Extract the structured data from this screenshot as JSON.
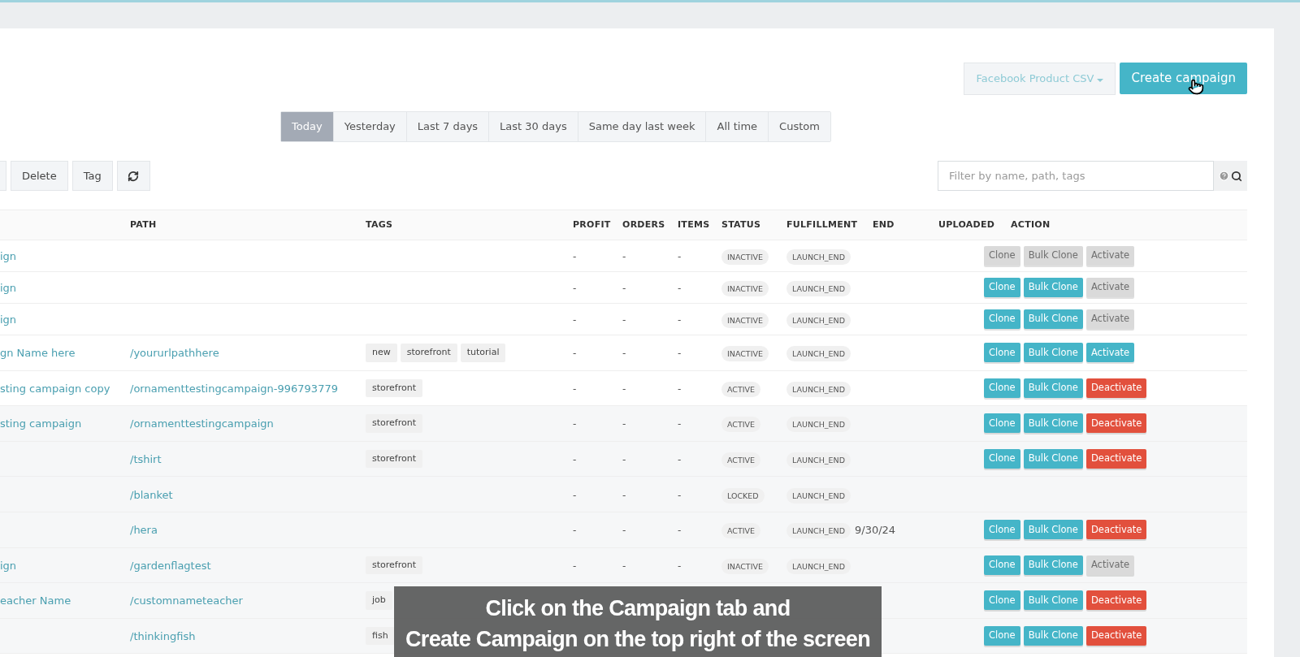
{
  "header_buttons": [
    {
      "label": "Facebook Product CSV",
      "kind": "dropdown"
    },
    {
      "label": "Create campaign",
      "kind": "primary"
    }
  ],
  "date_tabs": [
    {
      "label": "Today",
      "selected": true
    },
    {
      "label": "Yesterday",
      "selected": false
    },
    {
      "label": "Last 7 days",
      "selected": false
    },
    {
      "label": "Last 30 days",
      "selected": false
    },
    {
      "label": "Same day last week",
      "selected": false
    },
    {
      "label": "All time",
      "selected": false
    },
    {
      "label": "Custom",
      "selected": false
    }
  ],
  "toolbar": [
    {
      "label": "Delete",
      "kind": "text"
    },
    {
      "label": "Tag",
      "kind": "text"
    },
    {
      "kind": "refresh"
    }
  ],
  "filter": {
    "placeholder": "Filter by name, path, tags"
  },
  "table": {
    "columns": [
      "PATH",
      "TAGS",
      "PROFIT",
      "ORDERS",
      "ITEMS",
      "STATUS",
      "FULFILLMENT",
      "END",
      "UPLOADED",
      "ACTION"
    ],
    "rows": [
      {
        "name": "ign",
        "profit": "-",
        "orders": "-",
        "items": "-",
        "status": "INACTIVE",
        "fulfillment": "LAUNCH_END",
        "actions": [
          {
            "label": "Clone",
            "kind": "clone",
            "disabled": true
          },
          {
            "label": "Bulk Clone",
            "kind": "clone",
            "disabled": true
          },
          {
            "label": "Activate",
            "kind": "activate",
            "disabled": true
          }
        ]
      },
      {
        "name": "ign",
        "profit": "-",
        "orders": "-",
        "items": "-",
        "status": "INACTIVE",
        "fulfillment": "LAUNCH_END",
        "actions": [
          {
            "label": "Clone",
            "kind": "clone",
            "disabled": false
          },
          {
            "label": "Bulk Clone",
            "kind": "clone",
            "disabled": false
          },
          {
            "label": "Activate",
            "kind": "activate",
            "disabled": true
          }
        ]
      },
      {
        "name": "ign",
        "profit": "-",
        "orders": "-",
        "items": "-",
        "status": "INACTIVE",
        "fulfillment": "LAUNCH_END",
        "actions": [
          {
            "label": "Clone",
            "kind": "clone",
            "disabled": false
          },
          {
            "label": "Bulk Clone",
            "kind": "clone",
            "disabled": false
          },
          {
            "label": "Activate",
            "kind": "activate",
            "disabled": true
          }
        ]
      },
      {
        "name": "gn Name here",
        "path": "/yoururlpathhere",
        "tags": [
          "new",
          "storefront",
          "tutorial"
        ],
        "profit": "-",
        "orders": "-",
        "items": "-",
        "status": "INACTIVE",
        "fulfillment": "LAUNCH_END",
        "actions": [
          {
            "label": "Clone",
            "kind": "clone",
            "disabled": false
          },
          {
            "label": "Bulk Clone",
            "kind": "clone",
            "disabled": false
          },
          {
            "label": "Activate",
            "kind": "activate",
            "disabled": false
          }
        ]
      },
      {
        "name": "sting campaign copy",
        "path": "/ornamenttestingcampaign-996793779",
        "tags": [
          "storefront"
        ],
        "profit": "-",
        "orders": "-",
        "items": "-",
        "status": "ACTIVE",
        "fulfillment": "LAUNCH_END",
        "actions": [
          {
            "label": "Clone",
            "kind": "clone",
            "disabled": false
          },
          {
            "label": "Bulk Clone",
            "kind": "clone",
            "disabled": false
          },
          {
            "label": "Deactivate",
            "kind": "deactivate",
            "disabled": false
          }
        ]
      },
      {
        "name": "sting campaign",
        "path": "/ornamenttestingcampaign",
        "tags": [
          "storefront"
        ],
        "profit": "-",
        "orders": "-",
        "items": "-",
        "status": "ACTIVE",
        "fulfillment": "LAUNCH_END",
        "actions": [
          {
            "label": "Clone",
            "kind": "clone",
            "disabled": false
          },
          {
            "label": "Bulk Clone",
            "kind": "clone",
            "disabled": false
          },
          {
            "label": "Deactivate",
            "kind": "deactivate",
            "disabled": false
          }
        ]
      },
      {
        "path": "/tshirt",
        "tags": [
          "storefront"
        ],
        "profit": "-",
        "orders": "-",
        "items": "-",
        "status": "ACTIVE",
        "fulfillment": "LAUNCH_END",
        "actions": [
          {
            "label": "Clone",
            "kind": "clone",
            "disabled": false
          },
          {
            "label": "Bulk Clone",
            "kind": "clone",
            "disabled": false
          },
          {
            "label": "Deactivate",
            "kind": "deactivate",
            "disabled": false
          }
        ]
      },
      {
        "path": "/blanket",
        "profit": "-",
        "orders": "-",
        "items": "-",
        "status": "LOCKED",
        "fulfillment": "LAUNCH_END"
      },
      {
        "path": "/hera",
        "profit": "-",
        "orders": "-",
        "items": "-",
        "status": "ACTIVE",
        "fulfillment": "LAUNCH_END",
        "end": "9/30/24",
        "actions": [
          {
            "label": "Clone",
            "kind": "clone",
            "disabled": false
          },
          {
            "label": "Bulk Clone",
            "kind": "clone",
            "disabled": false
          },
          {
            "label": "Deactivate",
            "kind": "deactivate",
            "disabled": false
          }
        ]
      },
      {
        "name": "ign",
        "path": "/gardenflagtest",
        "tags": [
          "storefront"
        ],
        "profit": "-",
        "orders": "-",
        "items": "-",
        "status": "INACTIVE",
        "fulfillment": "LAUNCH_END",
        "actions": [
          {
            "label": "Clone",
            "kind": "clone",
            "disabled": false
          },
          {
            "label": "Bulk Clone",
            "kind": "clone",
            "disabled": false
          },
          {
            "label": "Activate",
            "kind": "activate",
            "disabled": true
          }
        ]
      },
      {
        "name": "eacher Name",
        "path": "/customnameteacher",
        "tags": [
          "job"
        ],
        "actions": [
          {
            "label": "Clone",
            "kind": "clone",
            "disabled": false
          },
          {
            "label": "Bulk Clone",
            "kind": "clone",
            "disabled": false
          },
          {
            "label": "Deactivate",
            "kind": "deactivate",
            "disabled": false
          }
        ]
      },
      {
        "path": "/thinkingfish",
        "tags": [
          "fish"
        ],
        "actions": [
          {
            "label": "Clone",
            "kind": "clone",
            "disabled": false
          },
          {
            "label": "Bulk Clone",
            "kind": "clone",
            "disabled": false
          },
          {
            "label": "Deactivate",
            "kind": "deactivate",
            "disabled": false
          }
        ]
      }
    ]
  },
  "caption": [
    "Click on the Campaign tab and",
    "Create Campaign on the top right of the screen"
  ]
}
